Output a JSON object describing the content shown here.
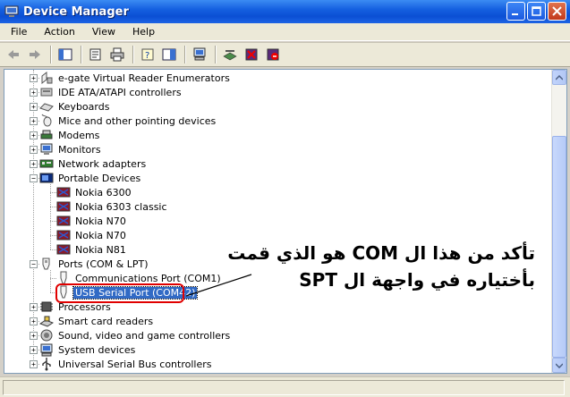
{
  "window": {
    "title": "Device Manager"
  },
  "menu": [
    "File",
    "Action",
    "View",
    "Help"
  ],
  "toolbar": [
    "back-icon",
    "forward-icon",
    "up-icon",
    "properties-icon",
    "print-icon",
    "help-icon",
    "show-hide-icon",
    "computer-icon",
    "scan-hardware-icon",
    "uninstall-icon",
    "disable-icon"
  ],
  "tree": {
    "categories": [
      {
        "label": "e-gate Virtual Reader Enumerators",
        "icon": "reader-icon",
        "expanded": false
      },
      {
        "label": "IDE ATA/ATAPI controllers",
        "icon": "ide-icon",
        "expanded": false
      },
      {
        "label": "Keyboards",
        "icon": "keyboard-icon",
        "expanded": false
      },
      {
        "label": "Mice and other pointing devices",
        "icon": "mouse-icon",
        "expanded": false
      },
      {
        "label": "Modems",
        "icon": "modem-icon",
        "expanded": false
      },
      {
        "label": "Monitors",
        "icon": "monitor-icon",
        "expanded": false
      },
      {
        "label": "Network adapters",
        "icon": "network-adapter-icon",
        "expanded": false
      },
      {
        "label": "Portable Devices",
        "icon": "portable-device-icon",
        "expanded": true,
        "children": [
          "Nokia 6300",
          "Nokia 6303 classic",
          "Nokia N70",
          "Nokia N70",
          "Nokia N81"
        ]
      },
      {
        "label": "Ports (COM & LPT)",
        "icon": "port-icon",
        "expanded": true,
        "children": [
          "Communications Port (COM1)",
          "USB Serial Port (COM42)"
        ]
      },
      {
        "label": "Processors",
        "icon": "processor-icon",
        "expanded": false
      },
      {
        "label": "Smart card readers",
        "icon": "smart-card-icon",
        "expanded": false
      },
      {
        "label": "Sound, video and game controllers",
        "icon": "sound-icon",
        "expanded": false
      },
      {
        "label": "System devices",
        "icon": "system-icon",
        "expanded": false
      },
      {
        "label": "Universal Serial Bus controllers",
        "icon": "usb-icon",
        "expanded": false
      }
    ],
    "selected": "USB Serial Port (COM42)"
  },
  "annotation": {
    "line1": "تأكد من هذا ال COM هو الذي قمت",
    "line2": "بأختياره في واجهة ال SPT"
  },
  "colors": {
    "selection": "#316ac5",
    "highlight_box": "#e00000",
    "titlebar": "#0b4fd4"
  }
}
